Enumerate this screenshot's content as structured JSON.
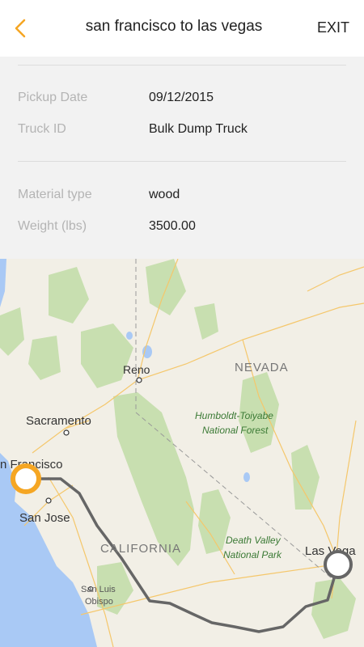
{
  "header": {
    "title": "san francisco to las vegas",
    "exit_label": "EXIT"
  },
  "details": {
    "rows": [
      {
        "label": "Pickup Date",
        "value": "09/12/2015"
      },
      {
        "label": "Truck ID",
        "value": "Bulk Dump Truck"
      },
      {
        "label": "Material type",
        "value": "wood"
      },
      {
        "label": "Weight (lbs)",
        "value": "3500.00"
      }
    ]
  },
  "map": {
    "labels": {
      "nevada": "NEVADA",
      "reno": "Reno",
      "sacramento": "Sacramento",
      "san_francisco": "n Francisco",
      "san_jose": "San Jose",
      "california": "CALIFORNIA",
      "humboldt_line1": "Humboldt-Toiyabe",
      "humboldt_line2": "National Forest",
      "death_valley_line1": "Death Valley",
      "death_valley_line2": "National Park",
      "san_luis_line1": "San Luis",
      "san_luis_line2": "Obispo",
      "las_vegas": "Las Vega"
    },
    "colors": {
      "origin_marker": "#f5a623",
      "route": "#666666",
      "water": "#a9c9f5",
      "land": "#f2efe6",
      "forest": "#c8dfb0"
    }
  },
  "icons": {
    "back": "chevron-left-icon"
  }
}
